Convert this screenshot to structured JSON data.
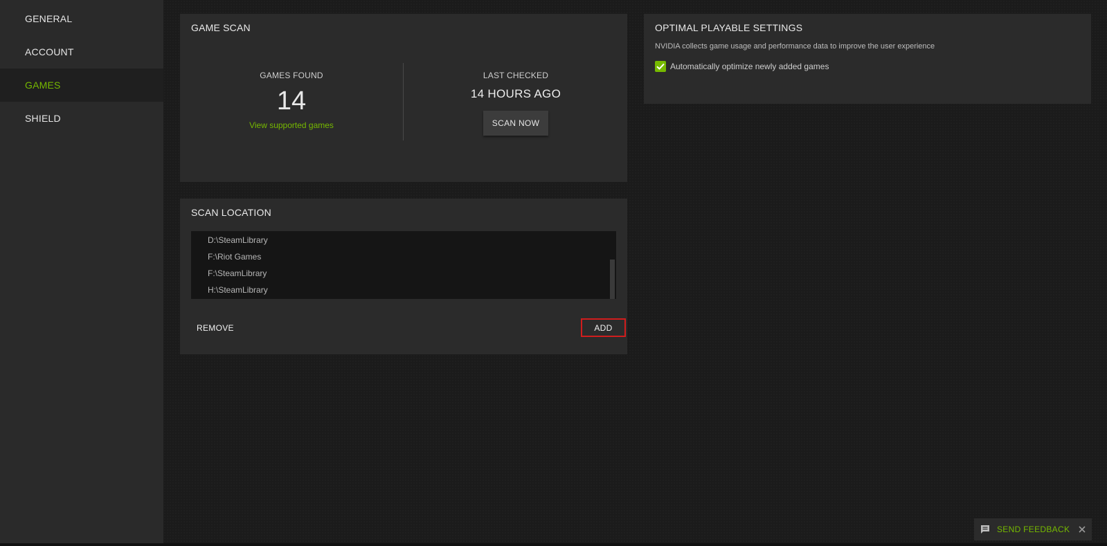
{
  "sidebar": {
    "items": [
      {
        "label": "GENERAL"
      },
      {
        "label": "ACCOUNT"
      },
      {
        "label": "GAMES"
      },
      {
        "label": "SHIELD"
      }
    ],
    "active": "GAMES"
  },
  "game_scan": {
    "title": "GAME SCAN",
    "games_found_label": "GAMES FOUND",
    "games_found_value": "14",
    "view_supported_link": "View supported games",
    "last_checked_label": "LAST CHECKED",
    "last_checked_value": "14 HOURS AGO",
    "scan_now_label": "SCAN NOW"
  },
  "scan_location": {
    "title": "SCAN LOCATION",
    "paths": [
      "D:\\SteamLibrary",
      "F:\\Riot Games",
      "F:\\SteamLibrary",
      "H:\\SteamLibrary"
    ],
    "remove_label": "REMOVE",
    "add_label": "ADD"
  },
  "optimal_playable": {
    "title": "OPTIMAL PLAYABLE SETTINGS",
    "description": "NVIDIA collects game usage and performance data to improve the user experience",
    "auto_optimize_label": "Automatically optimize newly added games",
    "auto_optimize_checked": true
  },
  "feedback": {
    "label": "SEND FEEDBACK"
  },
  "colors": {
    "accent": "#76b900",
    "highlight_border": "#d11d1d"
  }
}
